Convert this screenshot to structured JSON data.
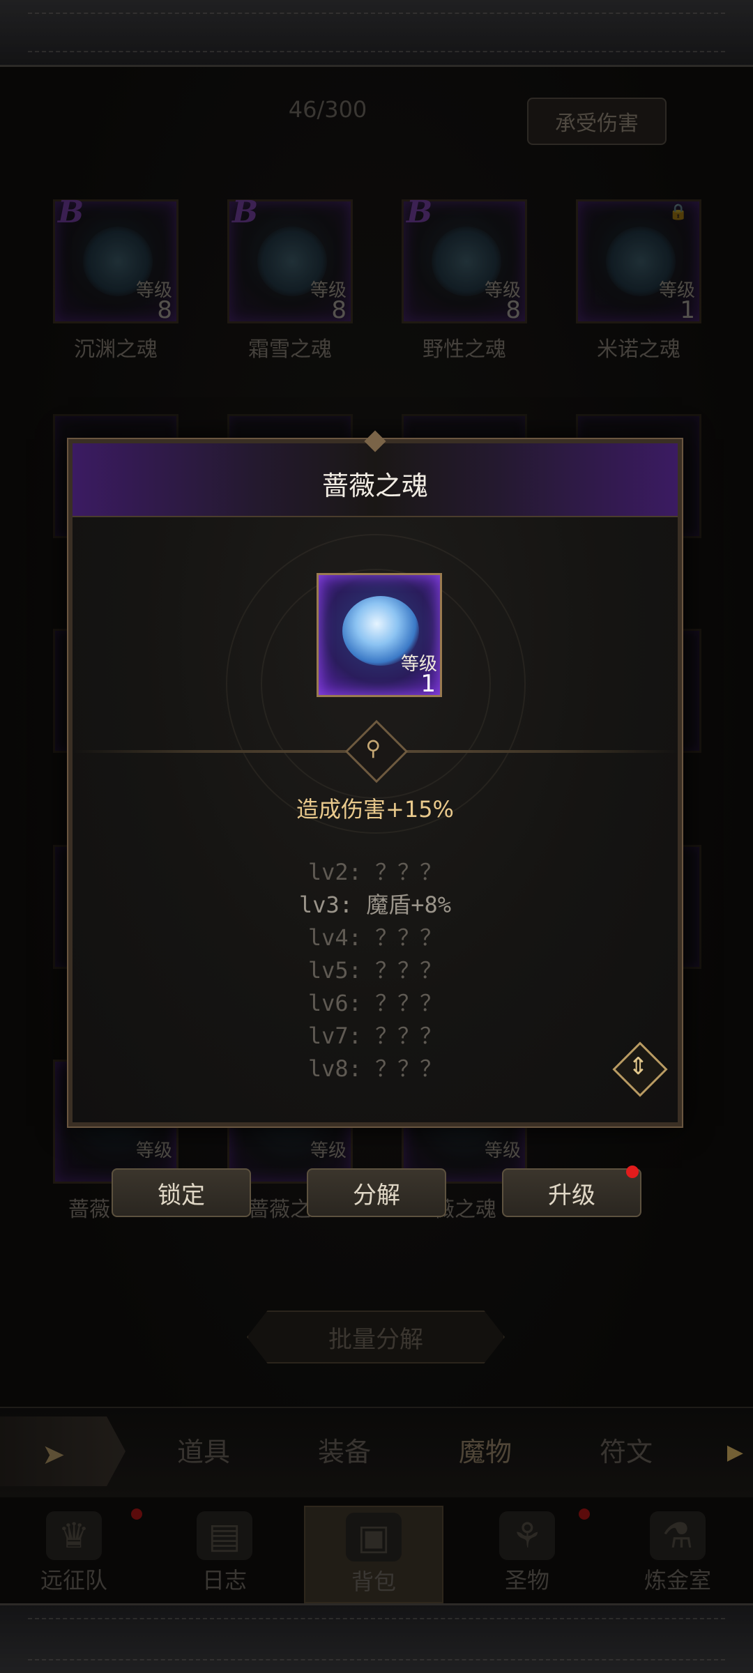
{
  "header": {
    "counter": "46/300",
    "damage_button": "承受伤害"
  },
  "souls_row1": [
    {
      "name": "沉渊之魂",
      "rank": "B",
      "level_label": "等级",
      "level": "8"
    },
    {
      "name": "霜雪之魂",
      "rank": "B",
      "level_label": "等级",
      "level": "8"
    },
    {
      "name": "野性之魂",
      "rank": "B",
      "level_label": "等级",
      "level": "8"
    },
    {
      "name": "米诺之魂",
      "rank": "",
      "level_label": "等级",
      "level": "1"
    }
  ],
  "souls_bottom": [
    {
      "name": "蔷薇",
      "level_label": "等级"
    },
    {
      "name": "蔷薇之",
      "level_label": "等级"
    },
    {
      "name": "薇之魂",
      "level_label": "等级"
    }
  ],
  "modal": {
    "title": "蔷薇之魂",
    "item": {
      "level_label": "等级",
      "level": "1"
    },
    "effect": "造成伤害+15%",
    "levels": [
      "lv2: ？？？",
      "lv3: 魔盾+8%",
      "lv4: ？？？",
      "lv5: ？？？",
      "lv6: ？？？",
      "lv7: ？？？",
      "lv8: ？？？"
    ],
    "actions": {
      "lock": "锁定",
      "decompose": "分解",
      "upgrade": "升级"
    }
  },
  "bulk_button": "批量分解",
  "tabs": [
    "道具",
    "装备",
    "魔物",
    "符文"
  ],
  "active_tab": "魔物",
  "bottom_nav": [
    {
      "label": "远征队",
      "icon": "helmet-icon"
    },
    {
      "label": "日志",
      "icon": "scroll-icon"
    },
    {
      "label": "背包",
      "icon": "backpack-icon"
    },
    {
      "label": "圣物",
      "icon": "chalice-icon"
    },
    {
      "label": "炼金室",
      "icon": "alchemy-icon"
    }
  ],
  "colors": {
    "rank_purple": "#a152e6",
    "effect_gold": "#e9c98c",
    "notify_red": "#e21c1c"
  }
}
